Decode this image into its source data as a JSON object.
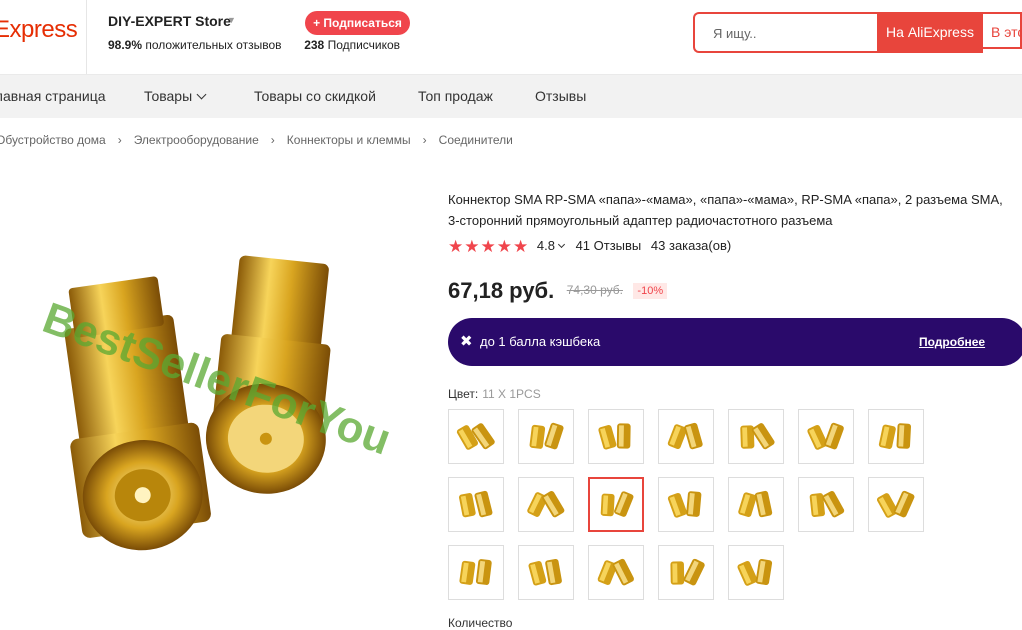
{
  "header": {
    "logo": "Express",
    "store_name": "DIY-EXPERT Store",
    "positive_pct": "98.9%",
    "positive_label": "положительных отзывов",
    "subscribers_count": "238",
    "subscribers_label": "Подписчиков",
    "subscribe_button": "+ Подписаться",
    "search_placeholder": "Я ищу..",
    "search_aliexpress_button": "На AliExpress",
    "search_store_button": "В этом магазине"
  },
  "nav": {
    "items": [
      "Главная страница",
      "Товары",
      "Товары со скидкой",
      "Топ продаж",
      "Отзывы"
    ]
  },
  "breadcrumb": [
    "Обустройство дома",
    "Электрооборудование",
    "Коннекторы и клеммы",
    "Соединители"
  ],
  "product": {
    "watermark": "BestSellerForYou",
    "title": "Коннектор SMA RP-SMA «папа»-«мама», «папа»-«мама», RP-SMA «папа», 2 разъема SMA, 3-сторонний прямоугольный адаптер радиочастотного разъема",
    "rating": "4.8",
    "stars_filled": 5,
    "reviews": "41 Отзывы",
    "orders": "43 заказа(ов)",
    "price": "67,18 руб.",
    "old_price": "74,30 руб.",
    "discount": "-10%",
    "cashback_text": "до 1 балла кэшбека",
    "cashback_link": "Подробнее",
    "color_label": "Цвет:",
    "color_value": "11 X 1PCS",
    "selected_swatch": 9,
    "swatch_count": 19,
    "quantity_label": "Количество"
  },
  "colors": {
    "brand_red": "#e8453c",
    "cashback_bg": "#2a0a6b",
    "star": "#f0454c",
    "watermark": "#5aa832",
    "brass": "#d4a017"
  }
}
